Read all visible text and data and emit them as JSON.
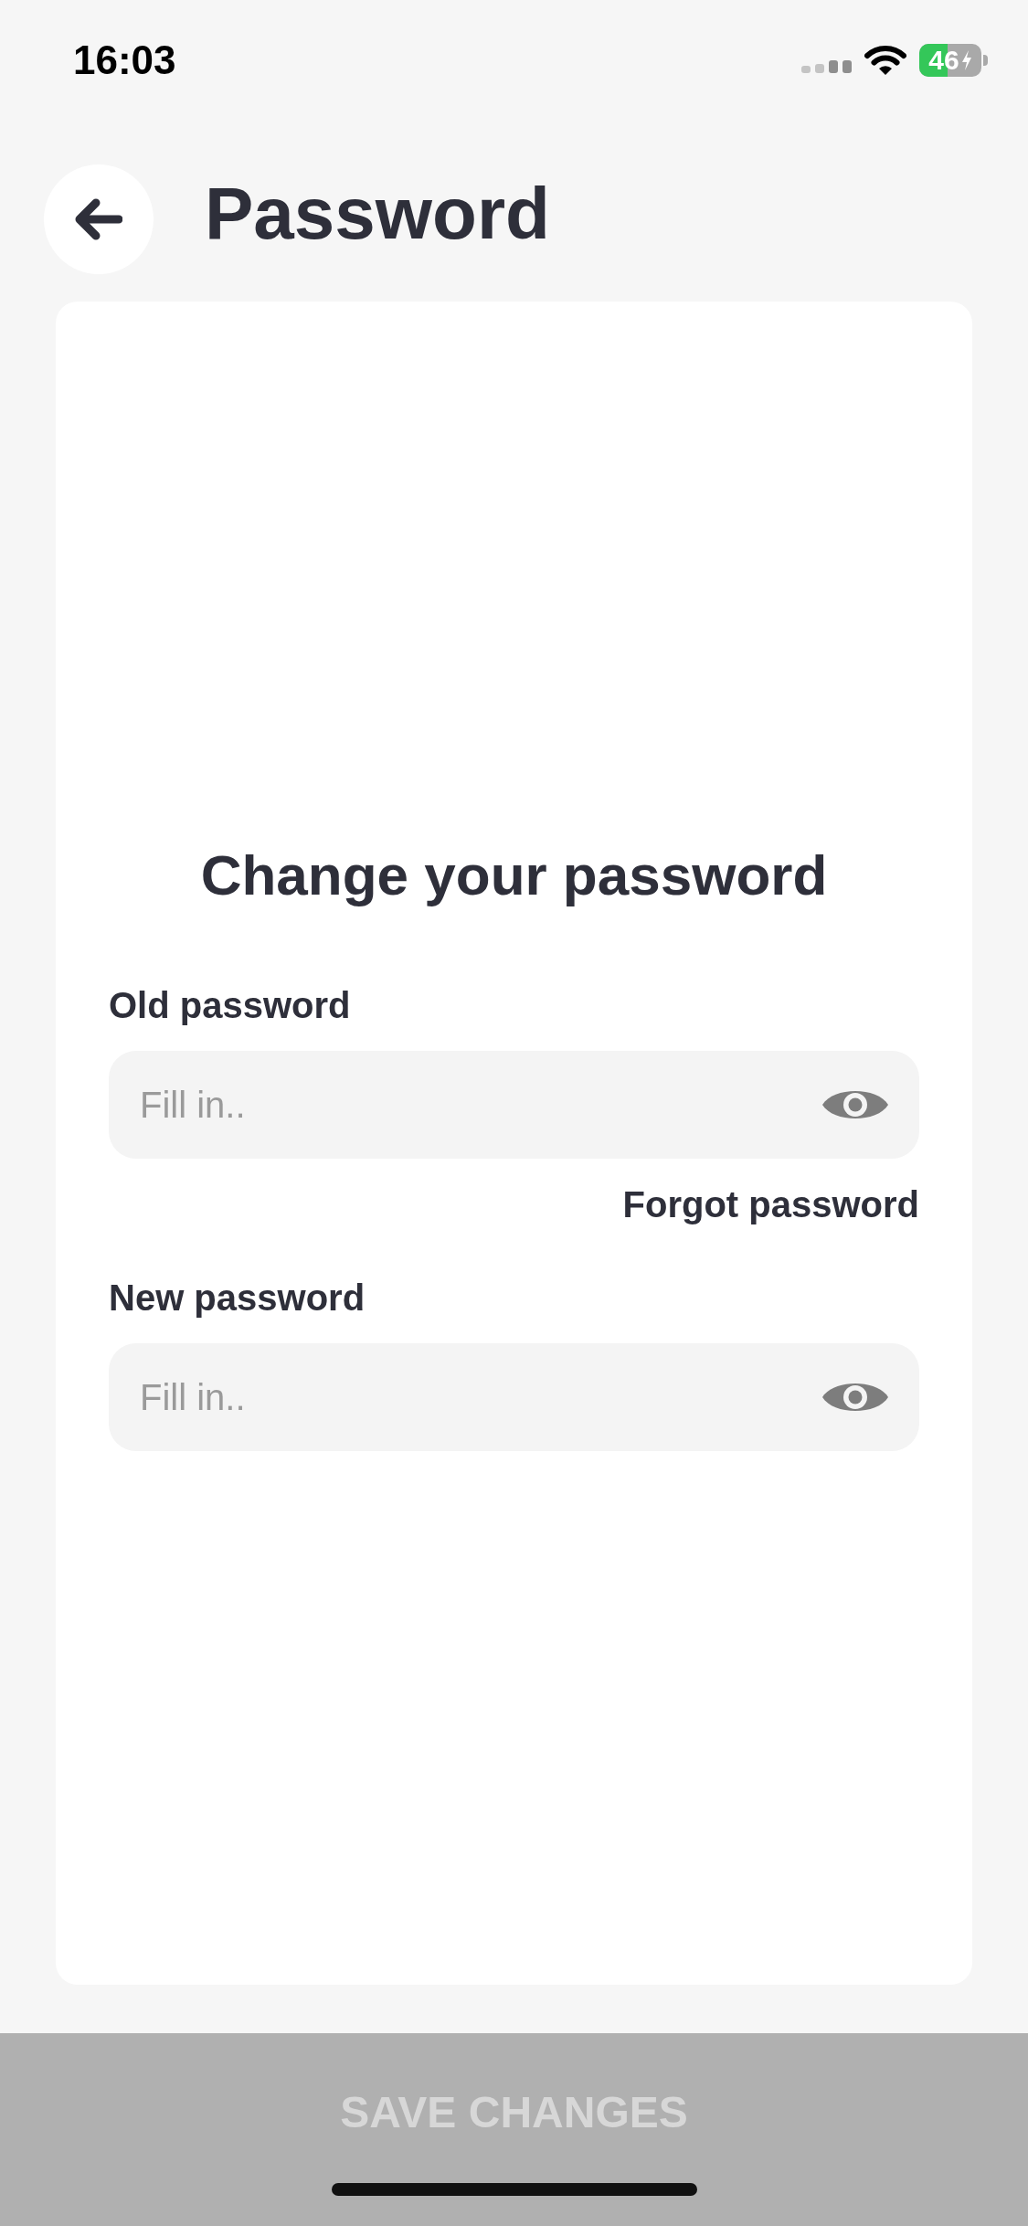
{
  "status_bar": {
    "time": "16:03",
    "battery": "46",
    "charging": true
  },
  "header": {
    "title": "Password"
  },
  "card": {
    "heading": "Change your password",
    "fields": [
      {
        "label": "Old password",
        "placeholder": "Fill in..",
        "link": "Forgot password"
      },
      {
        "label": "New password",
        "placeholder": "Fill in.."
      }
    ]
  },
  "save_button": {
    "label": "SAVE CHANGES",
    "disabled": true
  }
}
